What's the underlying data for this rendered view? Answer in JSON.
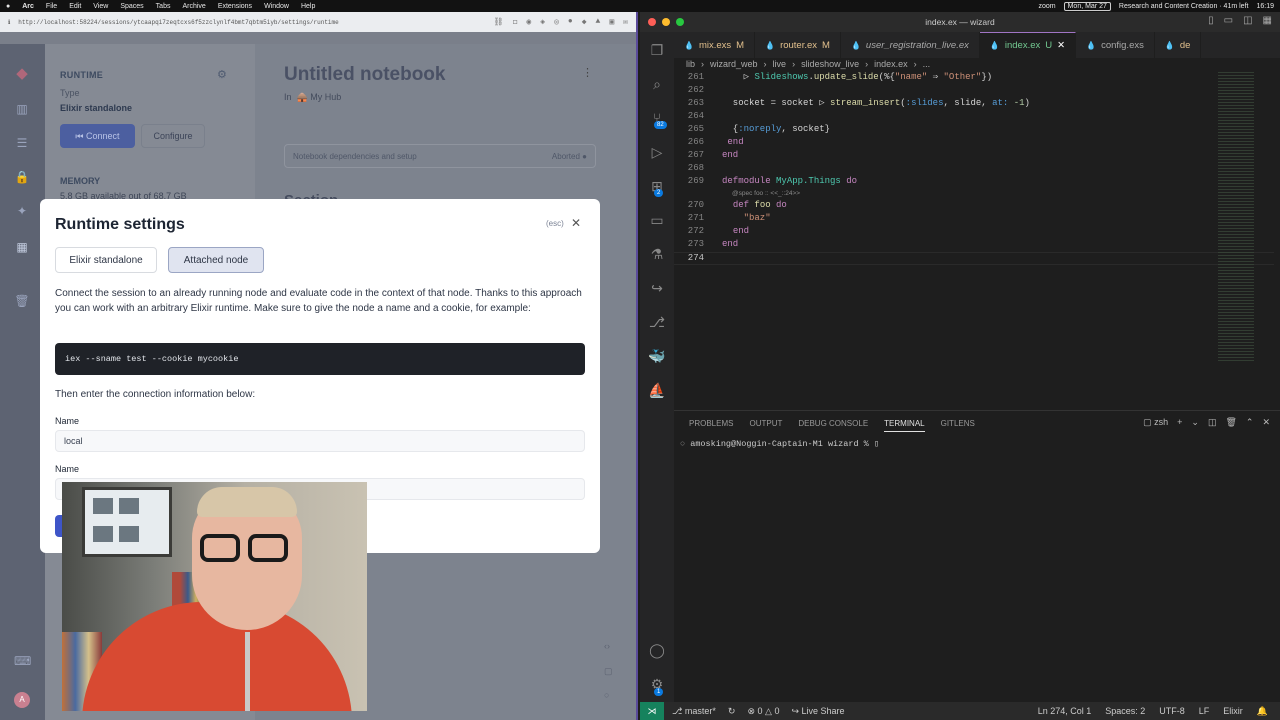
{
  "menubar": {
    "app": "Arc",
    "items": [
      "File",
      "Edit",
      "View",
      "Spaces",
      "Tabs",
      "Archive",
      "Extensions",
      "Window",
      "Help"
    ],
    "zoom_label": "zoom",
    "date": "Mon, Mar 27",
    "focus": "Research and Content Creation · 41m left",
    "time": "16:19"
  },
  "browser": {
    "url": "http://localhost:58224/sessions/ytcaapqi7zeqtcxs6f5zzclynlf4bmt7qbtm5iyb/settings/runtime"
  },
  "runtime_panel": {
    "heading": "RUNTIME",
    "type_label": "Type",
    "type_value": "Elixir standalone",
    "connect_label": "Connect",
    "configure_label": "Configure",
    "memory_heading": "MEMORY",
    "memory_value": "5.8 GB available out of 68.7 GB"
  },
  "notebook": {
    "title": "Untitled notebook",
    "in_label": "In",
    "hub": "My Hub",
    "deps_label": "Notebook dependencies and setup",
    "deps_status": "Aborted",
    "section": "Section"
  },
  "modal": {
    "title": "Runtime settings",
    "esc": "(esc)",
    "tabs": [
      "Elixir standalone",
      "Attached node"
    ],
    "description": "Connect the session to an already running node and evaluate code in the context of that node. Thanks to this approach you can work with an arbitrary Elixir runtime. Make sure to give the node a name and a cookie, for example:",
    "code": "iex --sname test --cookie mycookie",
    "then": "Then enter the connection information below:",
    "name_label": "Name",
    "name_value": "local",
    "cookie_label": "Name"
  },
  "vscode": {
    "window_title": "index.ex — wizard",
    "tabs": [
      {
        "label": "mix.exs",
        "flag": "M"
      },
      {
        "label": "router.ex",
        "flag": "M"
      },
      {
        "label": "user_registration_live.ex",
        "flag": ""
      },
      {
        "label": "index.ex",
        "flag": "U"
      },
      {
        "label": "config.exs",
        "flag": ""
      },
      {
        "label": "de",
        "flag": ""
      }
    ],
    "breadcrumbs": [
      "lib",
      "wizard_web",
      "live",
      "slideshow_live",
      "index.ex",
      "..."
    ],
    "line_numbers": [
      "261",
      "262",
      "263",
      "264",
      "265",
      "266",
      "267",
      "268",
      "269",
      "270",
      "271",
      "272",
      "273",
      "274"
    ],
    "inlay_hint": "@spec foo :: <<_::24>>",
    "scm_badge": "82",
    "ext_badge": "2",
    "settings_badge": "1",
    "panel_tabs": [
      "PROBLEMS",
      "OUTPUT",
      "DEBUG CONSOLE",
      "TERMINAL",
      "GITLENS"
    ],
    "shell": "zsh",
    "terminal_prompt": "amosking@Noggin-Captain-M1 wizard % ",
    "status": {
      "branch": "master*",
      "errors": "0",
      "warnings": "0",
      "live_share": "Live Share",
      "position": "Ln 274, Col 1",
      "spaces": "Spaces: 2",
      "encoding": "UTF-8",
      "eol": "LF",
      "language": "Elixir"
    }
  }
}
